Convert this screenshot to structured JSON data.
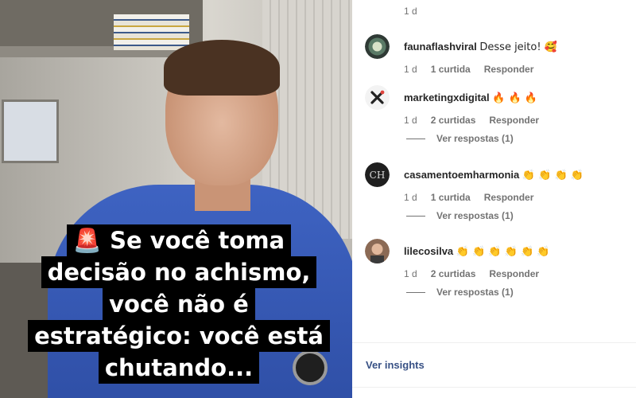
{
  "video": {
    "caption_lines": [
      "🚨 Se você toma",
      "decisão no achismo,",
      "você não é",
      "estratégico: você está",
      "chutando..."
    ]
  },
  "comments_panel": {
    "top_meta": {
      "time": "1 d"
    },
    "comments": [
      {
        "username": "faunaflashviral",
        "text": "Desse jeito! 🥰",
        "time": "1 d",
        "likes": "1 curtida",
        "reply": "Responder",
        "view_replies": ""
      },
      {
        "username": "marketingxdigital",
        "text": "🔥 🔥 🔥",
        "time": "1 d",
        "likes": "2 curtidas",
        "reply": "Responder",
        "view_replies": "Ver respostas (1)"
      },
      {
        "username": "casamentoemharmonia",
        "text": "👏 👏 👏 👏",
        "time": "1 d",
        "likes": "1 curtida",
        "reply": "Responder",
        "view_replies": "Ver respostas (1)"
      },
      {
        "username": "lilecosilva",
        "text": "👏 👏 👏 👏 👏 👏",
        "time": "1 d",
        "likes": "2 curtidas",
        "reply": "Responder",
        "view_replies": "Ver respostas (1)"
      }
    ],
    "insights_link": "Ver insights"
  },
  "colors": {
    "link_blue": "#385185",
    "meta_gray": "#737373",
    "text_dark": "#262626",
    "shirt_blue": "#3e63c2"
  }
}
